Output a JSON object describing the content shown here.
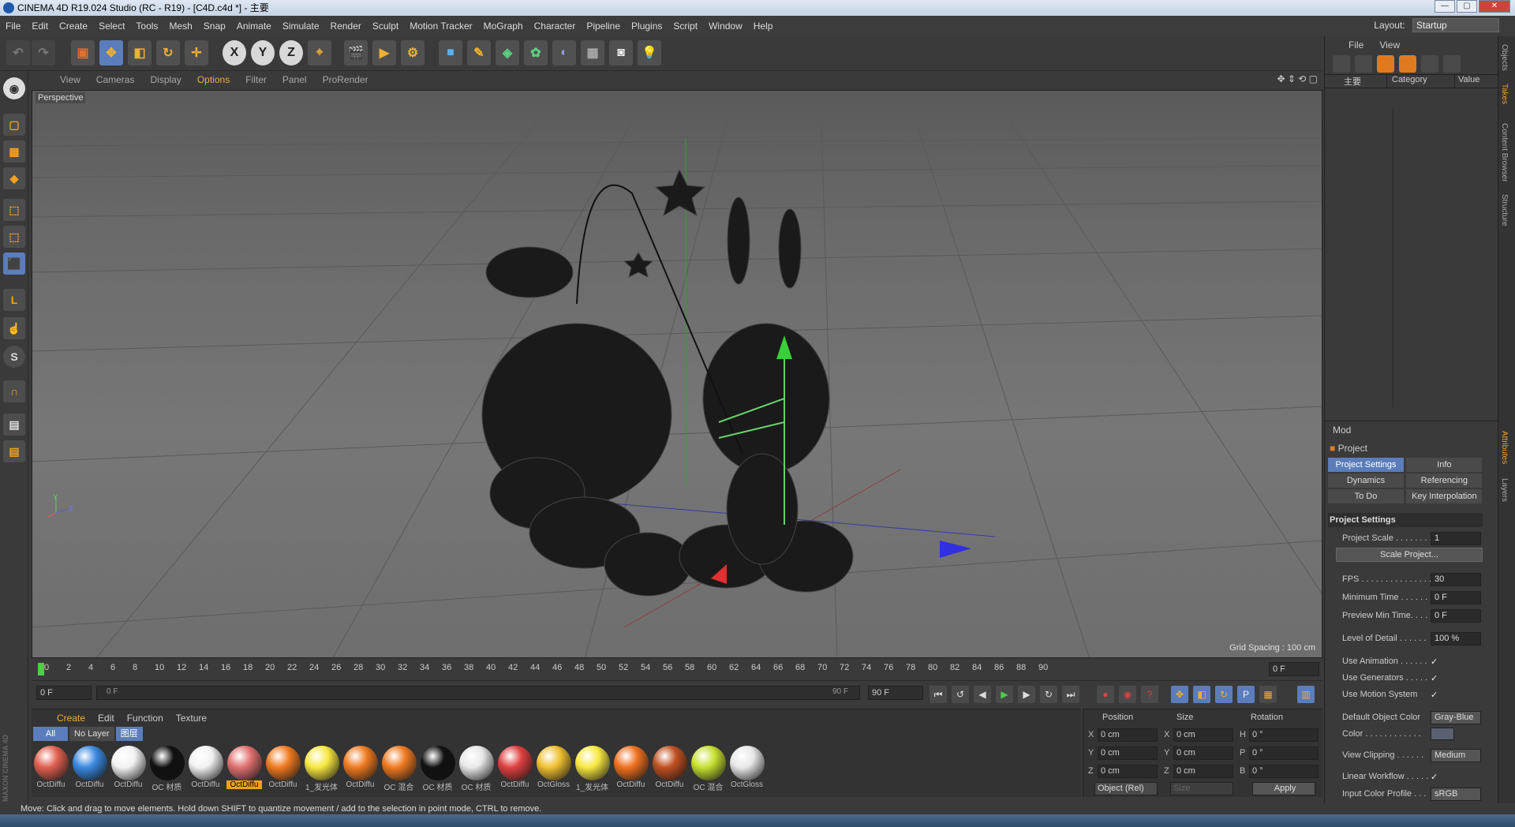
{
  "window": {
    "title": "CINEMA 4D R19.024 Studio (RC - R19) - [C4D.c4d *] - 主要"
  },
  "menubar": {
    "items": [
      "File",
      "Edit",
      "Create",
      "Select",
      "Tools",
      "Mesh",
      "Snap",
      "Animate",
      "Simulate",
      "Render",
      "Sculpt",
      "Motion Tracker",
      "MoGraph",
      "Character",
      "Pipeline",
      "Plugins",
      "Script",
      "Window",
      "Help"
    ],
    "layout_label": "Layout:",
    "layout_value": "Startup"
  },
  "viewport": {
    "menu": [
      "View",
      "Cameras",
      "Display",
      "Options",
      "Filter",
      "Panel",
      "ProRender"
    ],
    "camera_label": "Perspective",
    "grid_spacing": "Grid Spacing : 100 cm",
    "axis_y": "Y",
    "axis_z": "Z"
  },
  "timeline": {
    "ticks": [
      "0",
      "2",
      "4",
      "6",
      "8",
      "10",
      "12",
      "14",
      "16",
      "18",
      "20",
      "22",
      "24",
      "26",
      "28",
      "30",
      "32",
      "34",
      "36",
      "38",
      "40",
      "42",
      "44",
      "46",
      "48",
      "50",
      "52",
      "54",
      "56",
      "58",
      "60",
      "62",
      "64",
      "66",
      "68",
      "70",
      "72",
      "74",
      "76",
      "78",
      "80",
      "82",
      "84",
      "86",
      "88",
      "90"
    ],
    "current_frame": "0 F"
  },
  "transport": {
    "start": "0 F",
    "range_start": "0 F",
    "range_end": "90 F",
    "end": "90 F"
  },
  "materials": {
    "menu": [
      "Create",
      "Edit",
      "Function",
      "Texture"
    ],
    "filters": [
      "All",
      "No Layer",
      "图层"
    ],
    "items": [
      {
        "name": "OctDiffu",
        "color": "#e06050"
      },
      {
        "name": "OctDiffu",
        "color": "#3a88e0"
      },
      {
        "name": "OctDiffu",
        "color": "#f2f2f2"
      },
      {
        "name": "OC 材质",
        "color": "#111111"
      },
      {
        "name": "OctDiffu",
        "color": "#f2f2f2"
      },
      {
        "name": "OctDiffu",
        "color": "#e07070"
      },
      {
        "name": "OctDiffu",
        "color": "#f07a20"
      },
      {
        "name": "1_发光体",
        "color": "#f8e840"
      },
      {
        "name": "OctDiffu",
        "color": "#f07a20"
      },
      {
        "name": "OC 混合",
        "color": "#f07a20"
      },
      {
        "name": "OC 材质",
        "color": "#111111"
      },
      {
        "name": "OC 材质",
        "color": "#e8e8e8"
      },
      {
        "name": "OctDiffu",
        "color": "#e04040"
      },
      {
        "name": "OctGloss",
        "color": "#f0c030"
      },
      {
        "name": "1_发光体",
        "color": "#f8e840"
      },
      {
        "name": "OctDiffu",
        "color": "#f07020"
      },
      {
        "name": "OctDiffu",
        "color": "#c05020"
      },
      {
        "name": "OC 混合",
        "color": "#c8e030"
      },
      {
        "name": "OctGloss",
        "color": "#e8e8e8"
      }
    ],
    "selected_index": 5
  },
  "coords": {
    "headers": [
      "Position",
      "Size",
      "Rotation"
    ],
    "rows": [
      {
        "axis": "X",
        "pos": "0 cm",
        "saxis": "X",
        "size": "0 cm",
        "raxis": "H",
        "rot": "0 °"
      },
      {
        "axis": "Y",
        "pos": "0 cm",
        "saxis": "Y",
        "size": "0 cm",
        "raxis": "P",
        "rot": "0 °"
      },
      {
        "axis": "Z",
        "pos": "0 cm",
        "saxis": "Z",
        "size": "0 cm",
        "raxis": "B",
        "rot": "0 °"
      }
    ],
    "mode": "Object (Rel)",
    "size_mode": "Size",
    "apply": "Apply"
  },
  "objects": {
    "menu": [
      "File",
      "View"
    ],
    "columns": [
      "主要",
      "Category",
      "Value"
    ]
  },
  "attributes": {
    "menu": "Mod",
    "title": "Project",
    "tabs": [
      "Project Settings",
      "Info",
      "Dynamics",
      "Referencing",
      "To Do",
      "Key Interpolation"
    ],
    "section": "Project Settings",
    "project_scale_label": "Project Scale . . . . . . . .",
    "project_scale": "1",
    "scale_button": "Scale Project...",
    "fps_label": "FPS . . . . . . . . . . . . . . .",
    "fps": "30",
    "min_time_label": "Minimum Time . . . . . .",
    "min_time": "0 F",
    "preview_min_label": "Preview Min Time. . . .",
    "preview_min": "0 F",
    "lod_label": "Level of Detail . . . . . .",
    "lod": "100 %",
    "use_anim": "Use Animation . . . . . .",
    "use_gen": "Use Generators . . . . .",
    "use_motion": "Use Motion System",
    "check": "✓",
    "default_color_label": "Default Object Color",
    "default_color": "Gray-Blue",
    "color_label": "Color . . . . . . . . . . . .",
    "view_clip_label": "View Clipping . . . . . .",
    "view_clip": "Medium",
    "linear_label": "Linear Workflow . . . . .",
    "icp_label": "Input Color Profile . . .",
    "icp": "sRGB"
  },
  "sidetabs": [
    "Objects",
    "Takes",
    "Content Browser",
    "Structure",
    "Attributes",
    "Layers"
  ],
  "status": "Move: Click and drag to move elements. Hold down SHIFT to quantize movement / add to the selection in point mode, CTRL to remove.",
  "brand": "MAXON CINEMA 4D"
}
